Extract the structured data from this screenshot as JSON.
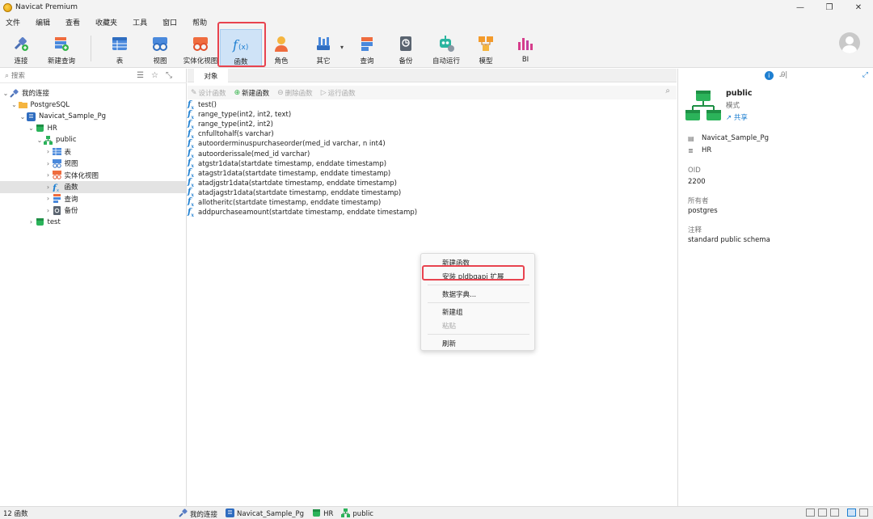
{
  "window": {
    "title": "Navicat Premium",
    "controls": [
      "—",
      "❐",
      "✕"
    ]
  },
  "menu": [
    "文件",
    "编辑",
    "查看",
    "收藏夹",
    "工具",
    "窗口",
    "帮助"
  ],
  "toolbar": {
    "buttons": [
      {
        "label": "连接",
        "icon": "connect-icon"
      },
      {
        "label": "新建查询",
        "icon": "new-query-icon"
      },
      {
        "label": "表",
        "icon": "table-icon"
      },
      {
        "label": "视图",
        "icon": "view-icon"
      },
      {
        "label": "实体化视图",
        "icon": "materialized-view-icon"
      },
      {
        "label": "函数",
        "icon": "function-icon",
        "active": true
      },
      {
        "label": "角色",
        "icon": "role-icon"
      },
      {
        "label": "其它",
        "icon": "other-icon"
      },
      {
        "label": "查询",
        "icon": "query-icon"
      },
      {
        "label": "备份",
        "icon": "backup-icon"
      },
      {
        "label": "自动运行",
        "icon": "automation-icon"
      },
      {
        "label": "模型",
        "icon": "model-icon"
      },
      {
        "label": "BI",
        "icon": "bi-icon"
      }
    ]
  },
  "nav": {
    "search_placeholder": "搜索",
    "tree": [
      {
        "label": "我的连接",
        "level": 0,
        "icon": "connections-icon",
        "chevron": "⌄"
      },
      {
        "label": "PostgreSQL",
        "level": 1,
        "icon": "folder-icon",
        "chevron": "⌄"
      },
      {
        "label": "Navicat_Sample_Pg",
        "level": 2,
        "icon": "server-icon",
        "chevron": "⌄"
      },
      {
        "label": "HR",
        "level": 3,
        "icon": "database-icon",
        "chevron": "⌄"
      },
      {
        "label": "public",
        "level": 4,
        "icon": "schema-icon",
        "chevron": "⌄"
      },
      {
        "label": "表",
        "level": 5,
        "icon": "table-icon",
        "chevron": "›"
      },
      {
        "label": "视图",
        "level": 5,
        "icon": "view-icon",
        "chevron": "›"
      },
      {
        "label": "实体化视图",
        "level": 5,
        "icon": "materialized-view-icon",
        "chevron": "›"
      },
      {
        "label": "函数",
        "level": 5,
        "icon": "function-icon",
        "chevron": "›",
        "selected": true
      },
      {
        "label": "查询",
        "level": 5,
        "icon": "query-icon",
        "chevron": "›"
      },
      {
        "label": "备份",
        "level": 5,
        "icon": "backup-icon",
        "chevron": "›"
      },
      {
        "label": "test",
        "level": 3,
        "icon": "database-icon",
        "chevron": "›"
      }
    ]
  },
  "center": {
    "tab_label": "对象",
    "obj_toolbar": [
      {
        "label": "设计函数",
        "icon": "✎",
        "disabled": true
      },
      {
        "label": "新建函数",
        "icon": "⊕",
        "disabled": false
      },
      {
        "label": "删除函数",
        "icon": "⊖",
        "disabled": true
      },
      {
        "label": "运行函数",
        "icon": "▷",
        "disabled": true
      }
    ],
    "functions": [
      "test()",
      "range_type(int2, int2, text)",
      "range_type(int2, int2)",
      "cnfulltohalf(s varchar)",
      "autoorderminuspurchaseorder(med_id varchar, n int4)",
      "autoorderissale(med_id varchar)",
      "atgstr1data(startdate timestamp, enddate timestamp)",
      "atagstr1data(startdate timestamp, enddate timestamp)",
      "atadjgstr1data(startdate timestamp, enddate timestamp)",
      "atadjagstr1data(startdate timestamp, enddate timestamp)",
      "allotheritc(startdate timestamp, enddate timestamp)",
      "addpurchaseamount(startdate timestamp, enddate timestamp)"
    ]
  },
  "context_menu": {
    "items": [
      {
        "label": "新建函数",
        "disabled": false
      },
      {
        "label": "安装 pldbgapi 扩展",
        "disabled": false,
        "highlighted": true
      },
      {
        "label": "数据字典...",
        "disabled": false
      },
      {
        "label": "新建组",
        "disabled": false
      },
      {
        "label": "粘贴",
        "disabled": true
      },
      {
        "label": "刷新",
        "disabled": false
      }
    ]
  },
  "info": {
    "title": "public",
    "subtitle": "模式",
    "share": "共享",
    "server": "Navicat_Sample_Pg",
    "database": "HR",
    "oid_label": "OID",
    "oid_value": "2200",
    "owner_label": "所有者",
    "owner_value": "postgres",
    "comment_label": "注释",
    "comment_value": "standard public schema"
  },
  "status": {
    "count": "12 函数",
    "path": [
      {
        "label": "我的连接",
        "icon": "connections-icon"
      },
      {
        "label": "Navicat_Sample_Pg",
        "icon": "server-icon"
      },
      {
        "label": "HR",
        "icon": "database-icon"
      },
      {
        "label": "public",
        "icon": "schema-icon"
      }
    ]
  },
  "colors": {
    "accent": "#1e7fd1",
    "highlight": "#e8434f",
    "selected_row": "#e3e3e3",
    "active_tool": "#cfe3f7"
  }
}
